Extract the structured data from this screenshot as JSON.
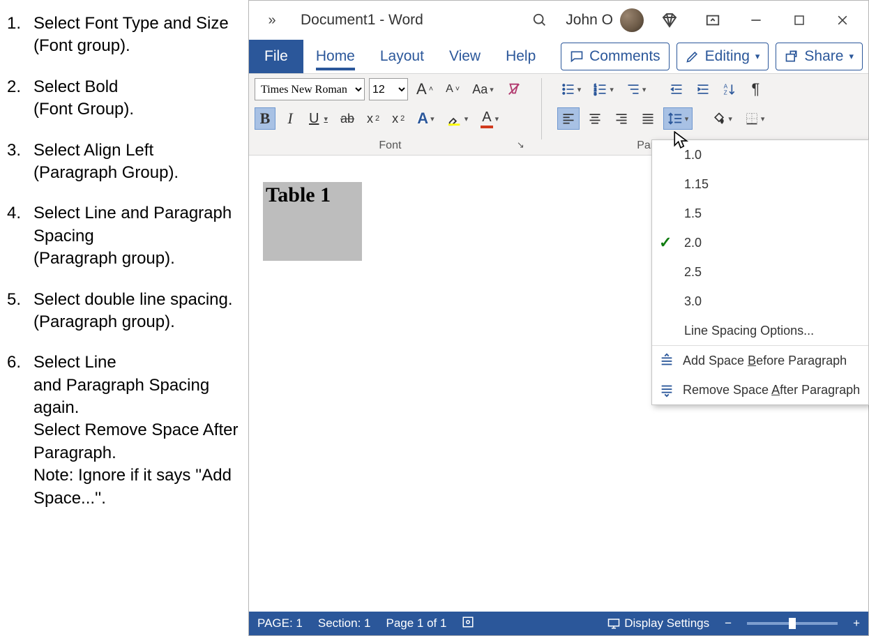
{
  "instructions": [
    "Select Font Type and Size\n(Font group).",
    "Select Bold\n (Font Group).",
    "Select Align Left\n (Paragraph Group).",
    "Select Line and Paragraph Spacing\n (Paragraph group).",
    "Select double line spacing.\n(Paragraph group).",
    "Select Line\nand Paragraph Spacing again.\nSelect Remove Space After Paragraph.\nNote: Ignore if it says ''Add Space...''."
  ],
  "titlebar": {
    "document": "Document1  -  Word",
    "user": "John O"
  },
  "tabs": {
    "file": "File",
    "items": [
      "Home",
      "Layout",
      "View",
      "Help"
    ],
    "active": "Home"
  },
  "actions": {
    "comments": "Comments",
    "editing": "Editing",
    "share": "Share"
  },
  "font_group": {
    "label": "Font",
    "name": "Times New Roman",
    "size": "12",
    "change_case": "Aa",
    "bold": "B",
    "italic": "I",
    "underline": "U",
    "strike": "ab",
    "subscript": "x",
    "superscript": "x"
  },
  "paragraph_group": {
    "label": "Paragraph"
  },
  "line_spacing_menu": {
    "options": [
      "1.0",
      "1.15",
      "1.5",
      "2.0",
      "2.5",
      "3.0"
    ],
    "selected": "2.0",
    "opts_label": "Line Spacing Options...",
    "add_before": "Add Space Before Paragraph",
    "remove_after": "Remove Space After Paragraph",
    "add_accent_char": "B",
    "remove_accent_char": "A"
  },
  "document": {
    "text": "Table 1"
  },
  "statusbar": {
    "page": "PAGE: 1",
    "section": "Section: 1",
    "page_of": "Page 1 of 1",
    "display": "Display Settings"
  }
}
